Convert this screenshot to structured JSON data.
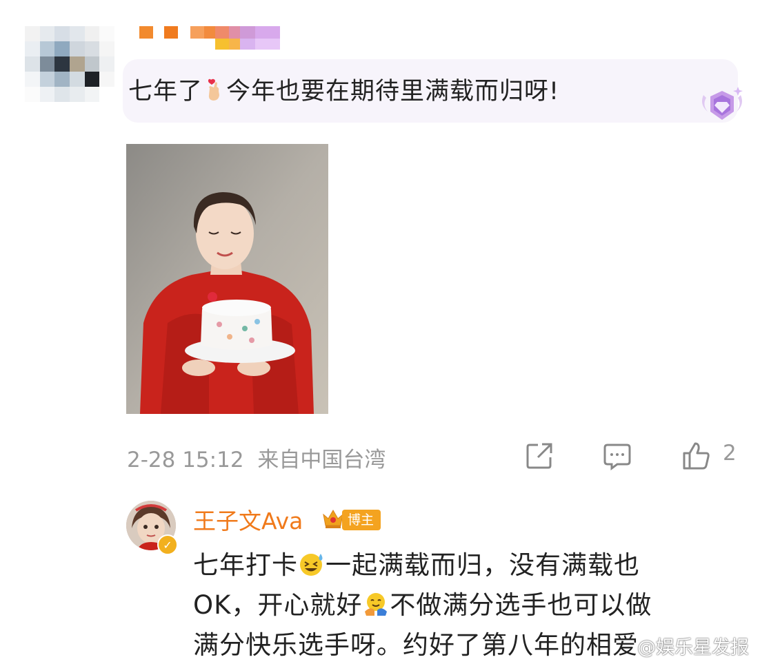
{
  "comment": {
    "text_before_emoji": "七年了",
    "emoji_1": "finger-heart-emoji",
    "text_after_emoji": "今年也要在期待里满载而归呀!",
    "timestamp": "2-28 15:12",
    "location": "来自中国台湾",
    "like_count": "2"
  },
  "reply": {
    "username": "王子文Ava",
    "role_tag": "博主",
    "line1_a": "七年打卡",
    "line1_emoji": "grinning-sweat-emoji",
    "line1_b": "一起满载而归，没有满载也",
    "line2_a": "OK，开心就好",
    "line2_emoji": "hug-emoji",
    "line2_b": "不做满分选手也可以做",
    "line3": "满分快乐选手呀。约好了第八年的相爱"
  },
  "watermark": "@娱乐星发报",
  "colors": {
    "bubble_bg": "#f7f4fb",
    "username_orange": "#f07a1b",
    "meta_gray": "#999999",
    "blogger_tag": "#f4a320"
  }
}
